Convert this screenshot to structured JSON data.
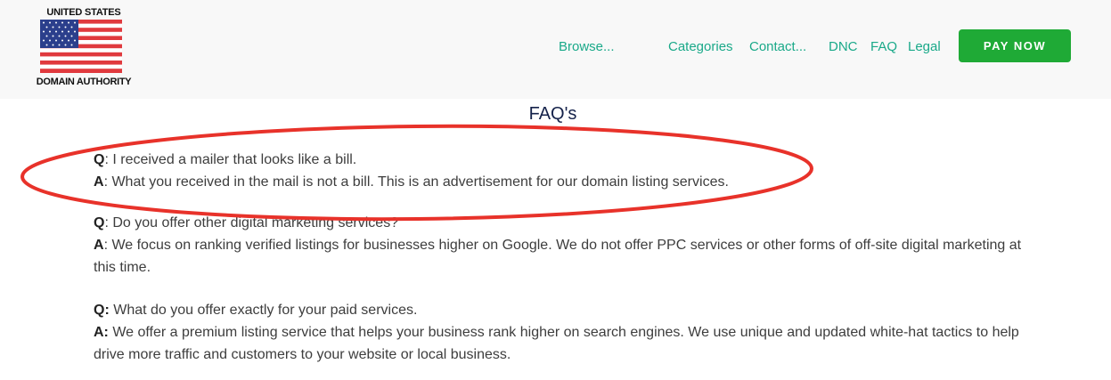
{
  "header": {
    "logo": {
      "top_text": "UNITED STATES",
      "bottom_text": "DOMAIN AUTHORITY"
    },
    "nav": [
      {
        "label": "Browse..."
      },
      {
        "label": "Categories"
      },
      {
        "label": "Contact..."
      },
      {
        "label": "DNC"
      },
      {
        "label": "FAQ"
      },
      {
        "label": "Legal"
      }
    ],
    "pay_button": "PAY NOW"
  },
  "main": {
    "title": "FAQ's",
    "faqs": [
      {
        "q_label": "Q",
        "q_sep": ": ",
        "question": "I received a mailer that looks like a bill.",
        "a_label": "A",
        "a_sep": ": ",
        "answer": "What you received in the mail is not a bill. This is an advertisement for our domain listing services."
      },
      {
        "q_label": "Q",
        "q_sep": ": ",
        "question": "Do you offer other digital marketing services?",
        "a_label": "A",
        "a_sep": ": ",
        "answer": "We focus on ranking verified listings for businesses higher on Google. We do not offer PPC services or other forms of off-site digital marketing at this time."
      },
      {
        "q_label": "Q:",
        "q_sep": " ",
        "question": "What do you offer exactly for your paid services.",
        "a_label": "A:",
        "a_sep": " ",
        "answer": "We offer a premium listing service that helps your business rank higher on search engines. We use unique and updated white-hat tactics to help drive more traffic and customers to your website or local business."
      }
    ]
  },
  "colors": {
    "nav_link": "#1aa989",
    "pay_button": "#1faa36",
    "title": "#15224a",
    "annotation": "#e8322a"
  },
  "icons": {
    "logo_flag": "us-flag-icon"
  }
}
